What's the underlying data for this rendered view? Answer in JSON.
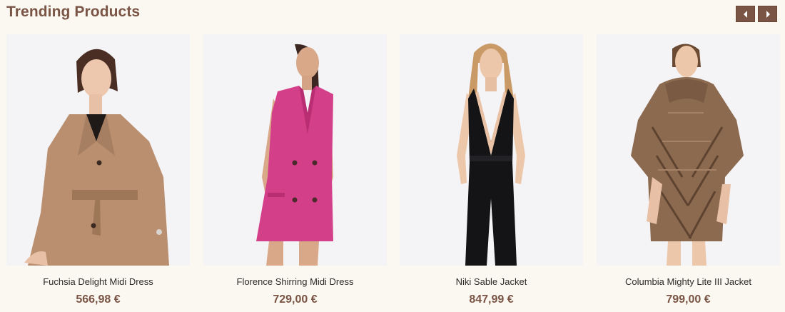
{
  "section": {
    "title": "Trending Products",
    "nav": {
      "prev_icon": "caret-left-icon",
      "next_icon": "caret-right-icon"
    },
    "accent_color": "#7a5545"
  },
  "products": [
    {
      "name": "Fuchsia Delight Midi Dress",
      "price": "566,98 €",
      "image": "woman-in-camel-belted-coat"
    },
    {
      "name": "Florence Shirring Midi Dress",
      "price": "729,00 €",
      "image": "woman-in-pink-blazer-dress"
    },
    {
      "name": "Niki Sable Jacket",
      "price": "847,99 €",
      "image": "woman-in-black-halter-jumpsuit"
    },
    {
      "name": "Columbia Mighty Lite III Jacket",
      "price": "799,00 €",
      "image": "woman-in-fur-cape-jacket"
    }
  ]
}
